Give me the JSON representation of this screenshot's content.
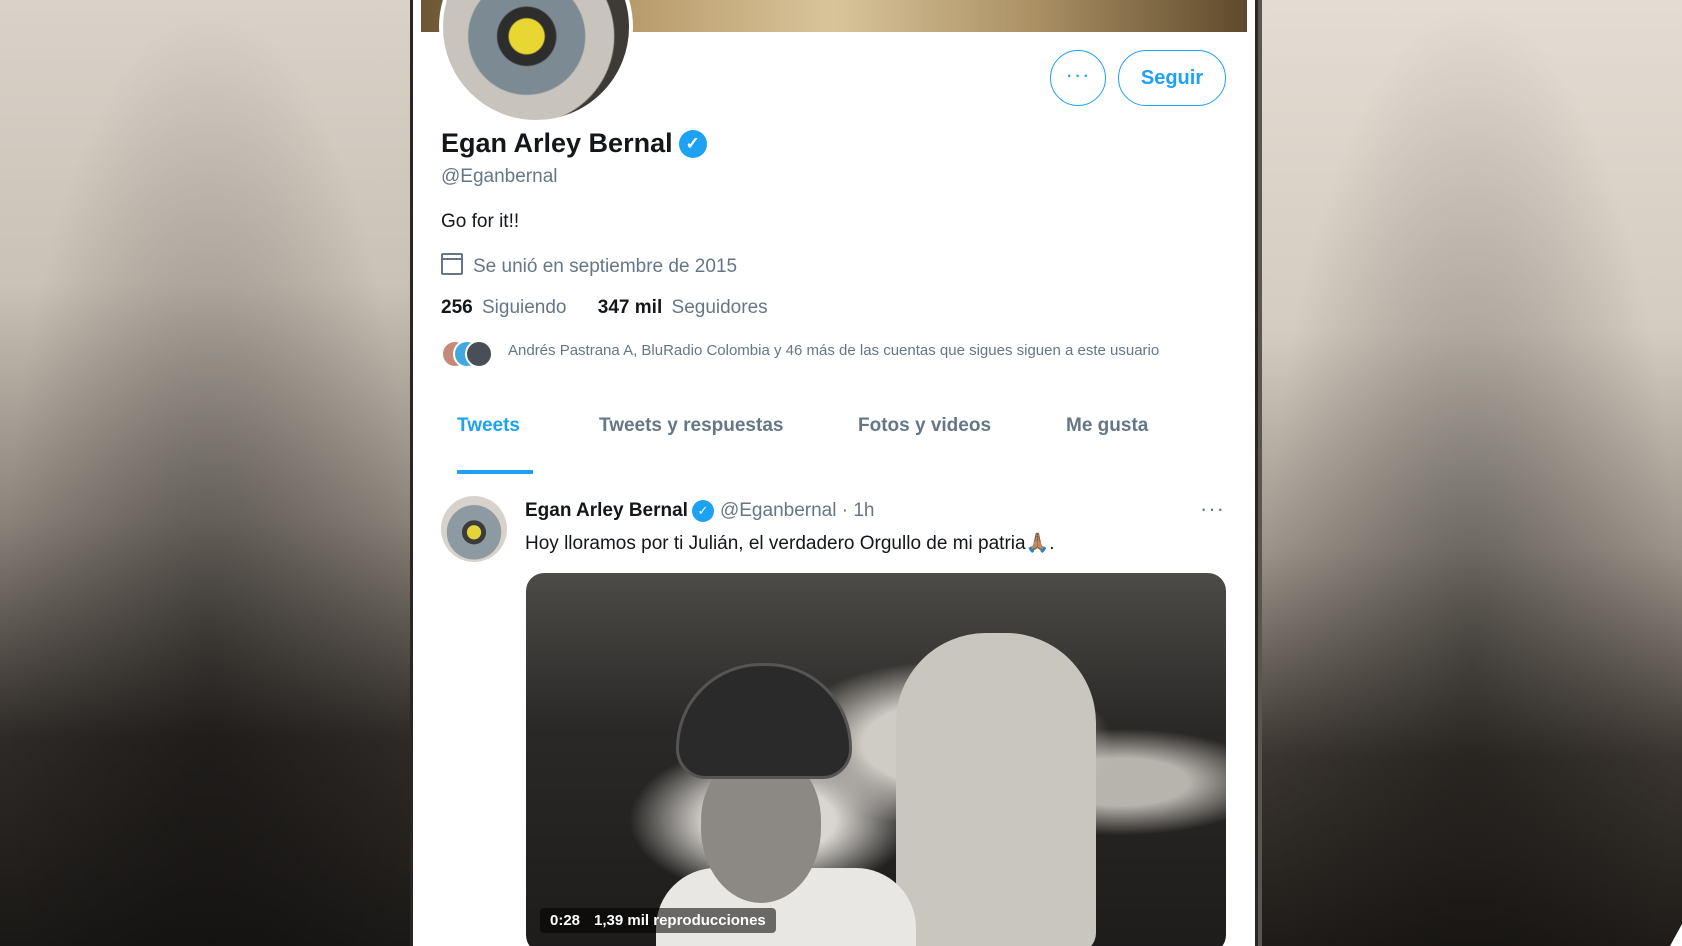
{
  "profile": {
    "name": "Egan Arley Bernal",
    "handle": "@Eganbernal",
    "bio": "Go for it!!",
    "joined": "Se unió en septiembre de 2015",
    "following_count": "256",
    "following_label": "Siguiendo",
    "followers_count": "347 mil",
    "followers_label": "Seguidores",
    "mutual_text": "Andrés Pastrana A, BluRadio Colombia y 46 más de las cuentas que sigues siguen a este usuario"
  },
  "actions": {
    "more_label": "···",
    "follow_label": "Seguir"
  },
  "icons": {
    "verified": "✓",
    "calendar": "calendar-icon"
  },
  "tabs": [
    {
      "label": "Tweets",
      "active": true
    },
    {
      "label": "Tweets y respuestas",
      "active": false
    },
    {
      "label": "Fotos y videos",
      "active": false
    },
    {
      "label": "Me gusta",
      "active": false
    }
  ],
  "tweet": {
    "author": "Egan Arley Bernal",
    "handle": "@Eganbernal",
    "time": "· 1h",
    "text": "Hoy lloramos por ti Julián, el verdadero Orgullo de mi patria🙏🏽.",
    "more_label": "···",
    "video_duration": "0:28",
    "video_views": "1,39 mil reproducciones"
  },
  "colors": {
    "accent": "#1da1f2",
    "text_primary": "#14171a",
    "text_secondary": "#657786"
  }
}
